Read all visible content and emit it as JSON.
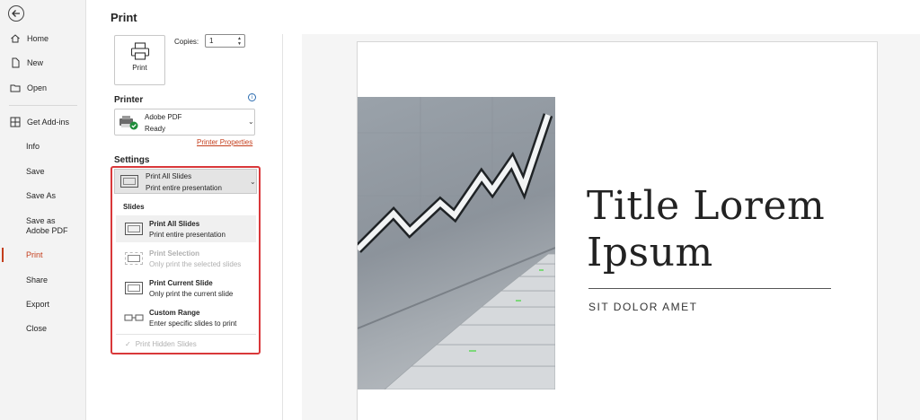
{
  "nav": {
    "items": [
      {
        "label": "Home",
        "icon": "home-icon"
      },
      {
        "label": "New",
        "icon": "new-icon"
      },
      {
        "label": "Open",
        "icon": "open-folder-icon"
      },
      {
        "label": "Get Add-ins",
        "icon": "add-ins-icon"
      },
      {
        "label": "Info"
      },
      {
        "label": "Save"
      },
      {
        "label": "Save As"
      },
      {
        "label": "Save as Adobe PDF"
      },
      {
        "label": "Print",
        "active": true
      },
      {
        "label": "Share"
      },
      {
        "label": "Export"
      },
      {
        "label": "Close"
      }
    ]
  },
  "print": {
    "title": "Print",
    "button_label": "Print",
    "copies_label": "Copies:",
    "copies_value": "1"
  },
  "printer": {
    "heading": "Printer",
    "name": "Adobe PDF",
    "status": "Ready",
    "properties_link": "Printer Properties"
  },
  "settings": {
    "heading": "Settings",
    "selected_title": "Print All Slides",
    "selected_subtitle": "Print entire presentation",
    "menu": {
      "section": "Slides",
      "items": [
        {
          "title": "Print All Slides",
          "subtitle": "Print entire presentation",
          "enabled": true
        },
        {
          "title": "Print Selection",
          "subtitle": "Only print the selected slides",
          "enabled": false
        },
        {
          "title": "Print Current Slide",
          "subtitle": "Only print the current slide",
          "enabled": true
        },
        {
          "title": "Custom Range",
          "subtitle": "Enter specific slides to print",
          "enabled": true
        }
      ],
      "hidden_slides": "Print Hidden Slides"
    }
  },
  "preview": {
    "title_line1": "Title Lorem",
    "title_line2": "Ipsum",
    "subtitle": "SIT DOLOR AMET"
  },
  "colors": {
    "accent": "#c43e1c",
    "highlight_border": "#d9383a"
  }
}
